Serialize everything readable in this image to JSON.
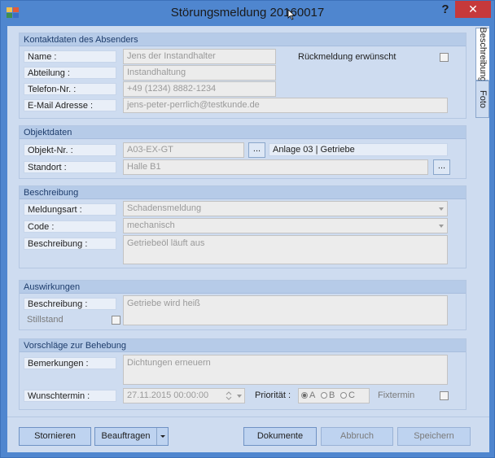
{
  "window": {
    "title": "Störungsmeldung 20160017",
    "help_label": "?",
    "close_label": "✕"
  },
  "tabs": [
    {
      "label": "Beschreibung"
    },
    {
      "label": "Foto"
    }
  ],
  "contact": {
    "header": "Kontaktdaten des Absenders",
    "name_label": "Name :",
    "name_value": "Jens der Instandhalter",
    "department_label": "Abteilung :",
    "department_value": "Instandhaltung",
    "phone_label": "Telefon-Nr. :",
    "phone_value": "+49 (1234) 8882-1234",
    "email_label": "E-Mail Adresse :",
    "email_value": "jens-peter-perrlich@testkunde.de",
    "feedback_label": "Rückmeldung erwünscht"
  },
  "object": {
    "header": "Objektdaten",
    "number_label": "Objekt-Nr. :",
    "number_value": "A03-EX-GT",
    "browse_label": "...",
    "description_value": "Anlage 03 | Getriebe",
    "location_label": "Standort :",
    "location_value": "Halle B1"
  },
  "description": {
    "header": "Beschreibung",
    "type_label": "Meldungsart :",
    "type_value": "Schadensmeldung",
    "code_label": "Code :",
    "code_value": "mechanisch",
    "text_label": "Beschreibung :",
    "text_value": "Getriebeöl läuft aus"
  },
  "effects": {
    "header": "Auswirkungen",
    "text_label": "Beschreibung :",
    "text_value": "Getriebe wird heiß",
    "standstill_label": "Stillstand"
  },
  "suggestions": {
    "header": "Vorschläge zur Behebung",
    "remarks_label": "Bemerkungen :",
    "remarks_value": "Dichtungen erneuern",
    "date_label": "Wunschtermin :",
    "date_value": "27.11.2015 00:00:00",
    "priority_label": "Priorität :",
    "priority_options": [
      "A",
      "B",
      "C"
    ],
    "priority_selected": "A",
    "fixed_label": "Fixtermin"
  },
  "buttons": {
    "cancel": "Stornieren",
    "assign": "Beauftragen",
    "documents": "Dokumente",
    "abort": "Abbruch",
    "save": "Speichern"
  },
  "colors": {
    "title_bar": "#4f86cf",
    "close_button": "#c6393b",
    "panel_background": "#cedcf0",
    "group_header": "#b6cbe8"
  }
}
